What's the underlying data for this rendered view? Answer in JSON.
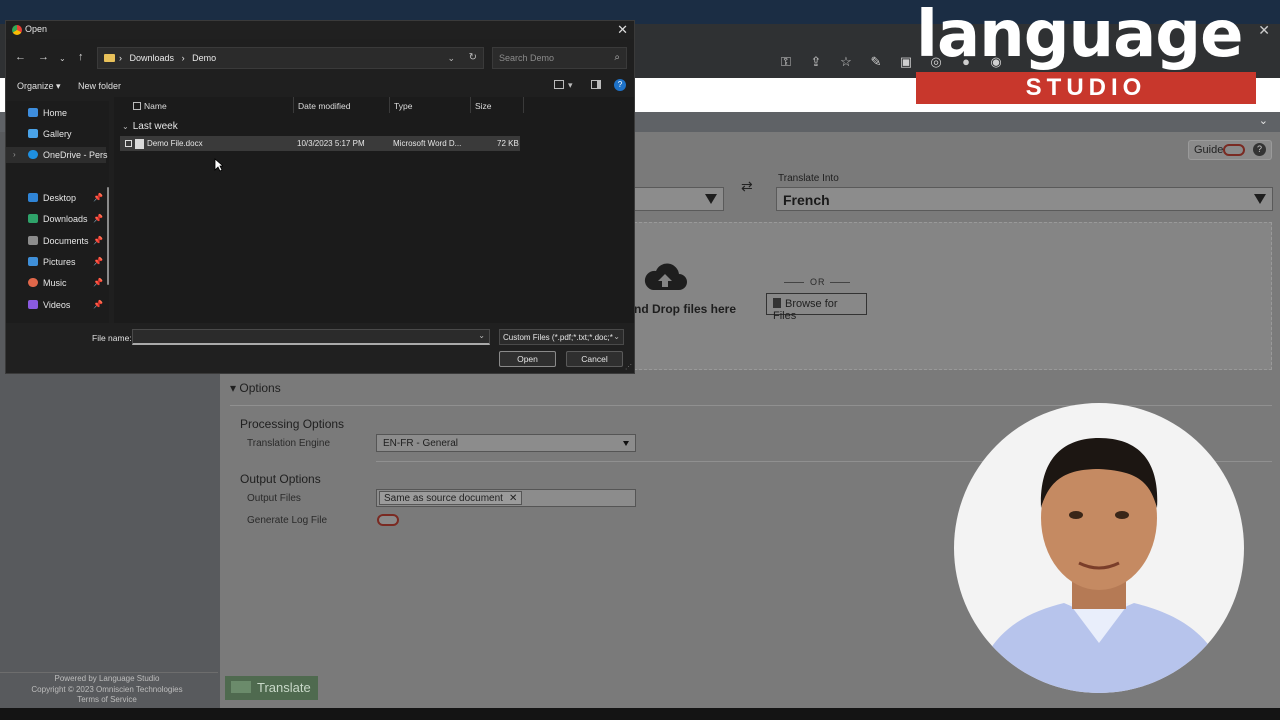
{
  "dialog": {
    "title": "Open",
    "path": [
      "Downloads",
      "Demo"
    ],
    "search_placeholder": "Search Demo",
    "organize": "Organize",
    "new_folder": "New folder",
    "nav_items": [
      {
        "label": "Home",
        "color": "#3e8ede"
      },
      {
        "label": "Gallery",
        "color": "#4aa3e8"
      },
      {
        "label": "OneDrive - Pers",
        "color": "#1e8fe0"
      },
      {
        "label": "Desktop",
        "color": "#2f84d6"
      },
      {
        "label": "Downloads",
        "color": "#2fa36a"
      },
      {
        "label": "Documents",
        "color": "#8c8c8c"
      },
      {
        "label": "Pictures",
        "color": "#3f8fd8"
      },
      {
        "label": "Music",
        "color": "#e0674a"
      },
      {
        "label": "Videos",
        "color": "#8a5adf"
      }
    ],
    "columns": {
      "name": "Name",
      "date": "Date modified",
      "type": "Type",
      "size": "Size"
    },
    "group": "Last week",
    "files": [
      {
        "name": "Demo File.docx",
        "date": "10/3/2023 5:17 PM",
        "type": "Microsoft Word D...",
        "size": "72 KB"
      }
    ],
    "file_name_label": "File name:",
    "file_name_value": "",
    "filter": "Custom Files (*.pdf;*.txt;*.doc;*",
    "open": "Open",
    "cancel": "Cancel"
  },
  "app": {
    "guide": "Guide",
    "help": "?",
    "translate_into_label": "Translate Into",
    "translate_into_value": "French",
    "drop_text": "nd Drop files here",
    "or": "OR",
    "browse": "Browse for Files",
    "options": "Options",
    "processing_options": "Processing Options",
    "translation_engine_label": "Translation Engine",
    "translation_engine_value": "EN-FR - General",
    "output_options": "Output Options",
    "output_files_label": "Output Files",
    "output_files_value": "Same as source document",
    "generate_log_label": "Generate Log File",
    "translate": "Translate",
    "footer": [
      "Powered by Language Studio",
      "Copyright © 2023 Omniscien Technologies",
      "Terms of Service"
    ]
  },
  "logo": {
    "word": "language",
    "sub": "STUDIO",
    "colors": {
      "bar": "#c8372c",
      "word": "#ffffff"
    }
  },
  "colors": {
    "accent": "#1e72c8",
    "toggle_off": "#7a2a22",
    "translate": "#4f6a4f"
  }
}
